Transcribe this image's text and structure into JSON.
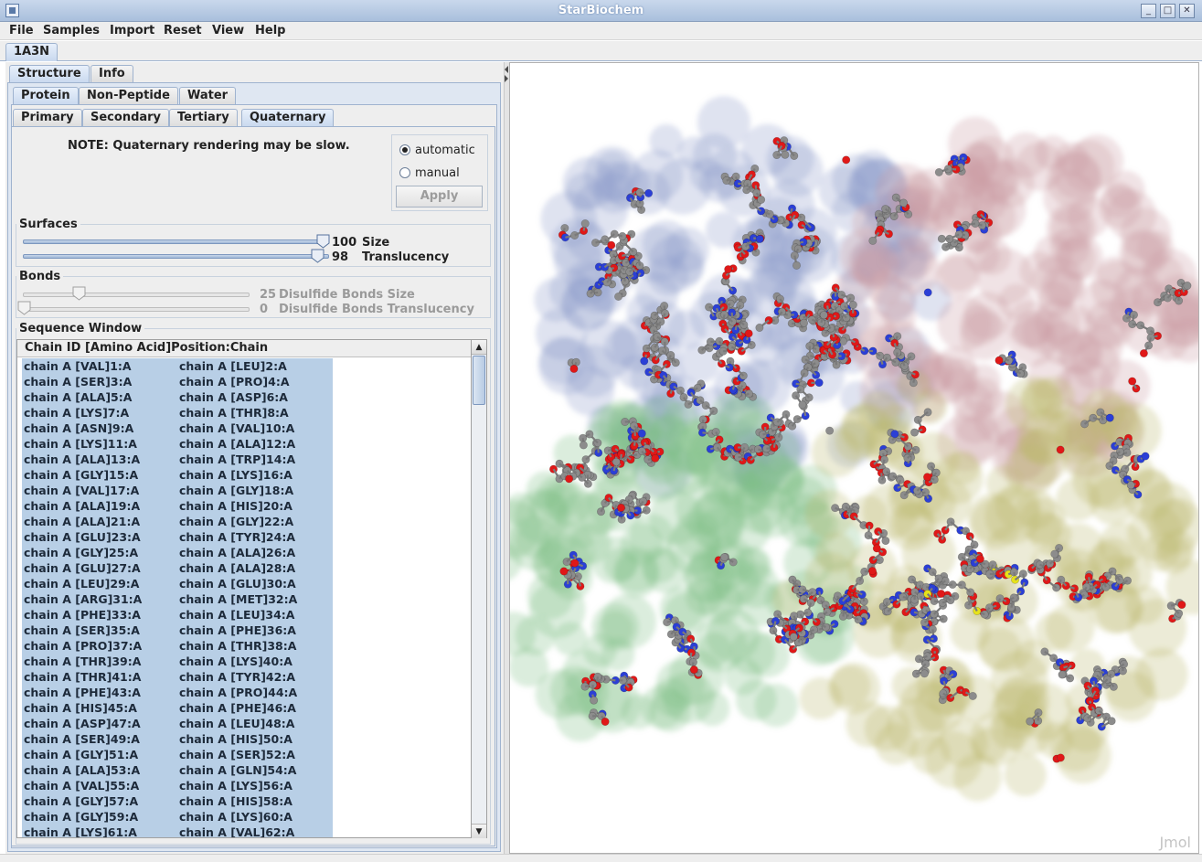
{
  "window": {
    "title": "StarBiochem"
  },
  "menu": [
    "File",
    "Samples",
    "Import",
    "Reset",
    "View",
    "Help"
  ],
  "document_tab": "1A3N",
  "tabs_level1": [
    "Structure",
    "Info"
  ],
  "tabs_level2": [
    "Protein",
    "Non-Peptide",
    "Water"
  ],
  "tabs_level3": [
    "Primary",
    "Secondary",
    "Tertiary",
    "Quaternary"
  ],
  "quaternary": {
    "note": "NOTE: Quaternary rendering may be slow.",
    "radio_automatic": "automatic",
    "radio_manual": "manual",
    "selected": "automatic",
    "apply_label": "Apply"
  },
  "surfaces": {
    "label": "Surfaces",
    "size_value": "100",
    "size_label": "Size",
    "size_level": 100,
    "translucency_value": "98",
    "translucency_label": "Translucency",
    "translucency_level": 98
  },
  "bonds": {
    "label": "Bonds",
    "size_value": "25",
    "size_label": "Disulfide Bonds Size",
    "size_level": 25,
    "translucency_value": "0",
    "translucency_label": "Disulfide Bonds Translucency",
    "translucency_level": 0
  },
  "sequence": {
    "label": "Sequence Window",
    "header": "Chain ID [Amino Acid]Position:Chain",
    "rows": [
      [
        "chain A [VAL]1:A",
        "chain A [LEU]2:A"
      ],
      [
        "chain A [SER]3:A",
        "chain A [PRO]4:A"
      ],
      [
        "chain A [ALA]5:A",
        "chain A [ASP]6:A"
      ],
      [
        "chain A [LYS]7:A",
        "chain A [THR]8:A"
      ],
      [
        "chain A [ASN]9:A",
        "chain A [VAL]10:A"
      ],
      [
        "chain A [LYS]11:A",
        "chain A [ALA]12:A"
      ],
      [
        "chain A [ALA]13:A",
        "chain A [TRP]14:A"
      ],
      [
        "chain A [GLY]15:A",
        "chain A [LYS]16:A"
      ],
      [
        "chain A [VAL]17:A",
        "chain A [GLY]18:A"
      ],
      [
        "chain A [ALA]19:A",
        "chain A [HIS]20:A"
      ],
      [
        "chain A [ALA]21:A",
        "chain A [GLY]22:A"
      ],
      [
        "chain A [GLU]23:A",
        "chain A [TYR]24:A"
      ],
      [
        "chain A [GLY]25:A",
        "chain A [ALA]26:A"
      ],
      [
        "chain A [GLU]27:A",
        "chain A [ALA]28:A"
      ],
      [
        "chain A [LEU]29:A",
        "chain A [GLU]30:A"
      ],
      [
        "chain A [ARG]31:A",
        "chain A [MET]32:A"
      ],
      [
        "chain A [PHE]33:A",
        "chain A [LEU]34:A"
      ],
      [
        "chain A [SER]35:A",
        "chain A [PHE]36:A"
      ],
      [
        "chain A [PRO]37:A",
        "chain A [THR]38:A"
      ],
      [
        "chain A [THR]39:A",
        "chain A [LYS]40:A"
      ],
      [
        "chain A [THR]41:A",
        "chain A [TYR]42:A"
      ],
      [
        "chain A [PHE]43:A",
        "chain A [PRO]44:A"
      ],
      [
        "chain A [HIS]45:A",
        "chain A [PHE]46:A"
      ],
      [
        "chain A [ASP]47:A",
        "chain A [LEU]48:A"
      ],
      [
        "chain A [SER]49:A",
        "chain A [HIS]50:A"
      ],
      [
        "chain A [GLY]51:A",
        "chain A [SER]52:A"
      ],
      [
        "chain A [ALA]53:A",
        "chain A [GLN]54:A"
      ],
      [
        "chain A [VAL]55:A",
        "chain A [LYS]56:A"
      ],
      [
        "chain A [GLY]57:A",
        "chain A [HIS]58:A"
      ],
      [
        "chain A [GLY]59:A",
        "chain A [LYS]60:A"
      ],
      [
        "chain A [LYS]61:A",
        "chain A [VAL]62:A"
      ]
    ]
  },
  "viewer": {
    "watermark": "Jmol",
    "colors": {
      "surface_blue": "#8d9cc9",
      "surface_red": "#c99aa0",
      "surface_green": "#7fbf86",
      "surface_yellow": "#b9b66a",
      "atom_carbon": "#8c8c8c",
      "atom_oxygen": "#e01818",
      "atom_nitrogen": "#2b3fd6",
      "atom_sulfur": "#e6e21a"
    }
  }
}
